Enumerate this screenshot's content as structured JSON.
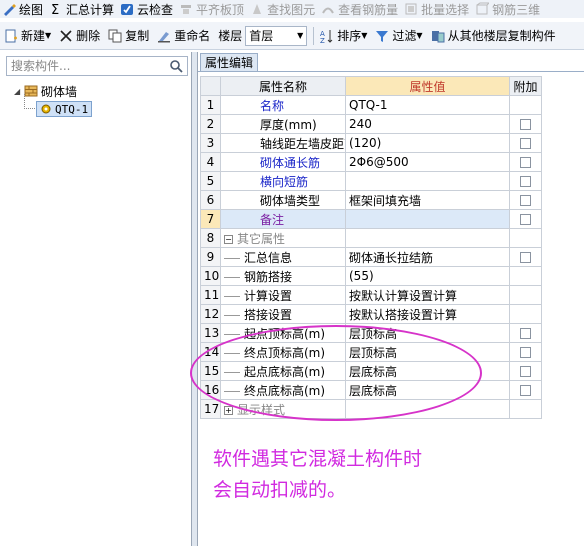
{
  "toolbar_top": {
    "items": [
      {
        "label": "绘图",
        "icon": "draw-icon",
        "disabled": false
      },
      {
        "label": "汇总计算",
        "icon": "sigma-icon",
        "disabled": false
      },
      {
        "label": "云检查",
        "icon": "cloud-check-icon",
        "disabled": false
      },
      {
        "label": "平齐板顶",
        "icon": "align-top-icon",
        "disabled": true
      },
      {
        "label": "查找图元",
        "icon": "find-element-icon",
        "disabled": true
      },
      {
        "label": "查看钢筋量",
        "icon": "view-rebar-icon",
        "disabled": true
      },
      {
        "label": "批量选择",
        "icon": "batch-select-icon",
        "disabled": true
      },
      {
        "label": "钢筋三维",
        "icon": "rebar-3d-icon",
        "disabled": true
      }
    ]
  },
  "toolbar_main": {
    "new_label": "新建",
    "delete_label": "删除",
    "copy_label": "复制",
    "rename_label": "重命名",
    "floor_label": "楼层",
    "floor_value": "首层",
    "sort_label": "排序",
    "filter_label": "过滤",
    "copy_from_label": "从其他楼层复制构件"
  },
  "left_panel": {
    "search_placeholder": "搜索构件...",
    "tree_root": "砌体墙",
    "tree_child": "QTQ-1"
  },
  "right_panel": {
    "tab_label": "属性编辑",
    "columns": {
      "name": "属性名称",
      "value": "属性值",
      "extra": "附加"
    },
    "rows": [
      {
        "num": "1",
        "name": "名称",
        "value": "QTQ-1",
        "style": "blue",
        "check": false
      },
      {
        "num": "2",
        "name": "厚度(mm)",
        "value": "240",
        "style": "normal",
        "check": true
      },
      {
        "num": "3",
        "name": "轴线距左墙皮距离",
        "value": "(120)",
        "style": "normal",
        "check": true
      },
      {
        "num": "4",
        "name": "砌体通长筋",
        "value": "2Φ6@500",
        "style": "blue",
        "check": true
      },
      {
        "num": "5",
        "name": "横向短筋",
        "value": "",
        "style": "blue",
        "check": true
      },
      {
        "num": "6",
        "name": "砌体墙类型",
        "value": "框架间填充墙",
        "style": "normal",
        "check": true
      },
      {
        "num": "7",
        "name": "备注",
        "value": "",
        "style": "selected",
        "check": true
      },
      {
        "num": "8",
        "name": "其它属性",
        "value": "",
        "style": "group",
        "check": false
      },
      {
        "num": "9",
        "name": "汇总信息",
        "value": "砌体通长拉结筋",
        "style": "child",
        "check": true
      },
      {
        "num": "10",
        "name": "钢筋搭接",
        "value": "(55)",
        "style": "child",
        "check": false
      },
      {
        "num": "11",
        "name": "计算设置",
        "value": "按默认计算设置计算",
        "style": "child",
        "check": false
      },
      {
        "num": "12",
        "name": "搭接设置",
        "value": "按默认搭接设置计算",
        "style": "child",
        "check": false
      },
      {
        "num": "13",
        "name": "起点顶标高(m)",
        "value": "层顶标高",
        "style": "child",
        "check": true
      },
      {
        "num": "14",
        "name": "终点顶标高(m)",
        "value": "层顶标高",
        "style": "child",
        "check": true
      },
      {
        "num": "15",
        "name": "起点底标高(m)",
        "value": "层底标高",
        "style": "child",
        "check": true
      },
      {
        "num": "16",
        "name": "终点底标高(m)",
        "value": "层底标高",
        "style": "child",
        "check": true
      },
      {
        "num": "17",
        "name": "显示样式",
        "value": "",
        "style": "group-collapsed",
        "check": false
      }
    ]
  },
  "annotation": {
    "line1": "软件遇其它混凝土构件时",
    "line2": "会自动扣减的。",
    "color": "#d12ae0"
  },
  "colors": {
    "blue_text": "#1a25c8",
    "highlight": "#d633c9",
    "value_header": "#fbe8b8"
  }
}
